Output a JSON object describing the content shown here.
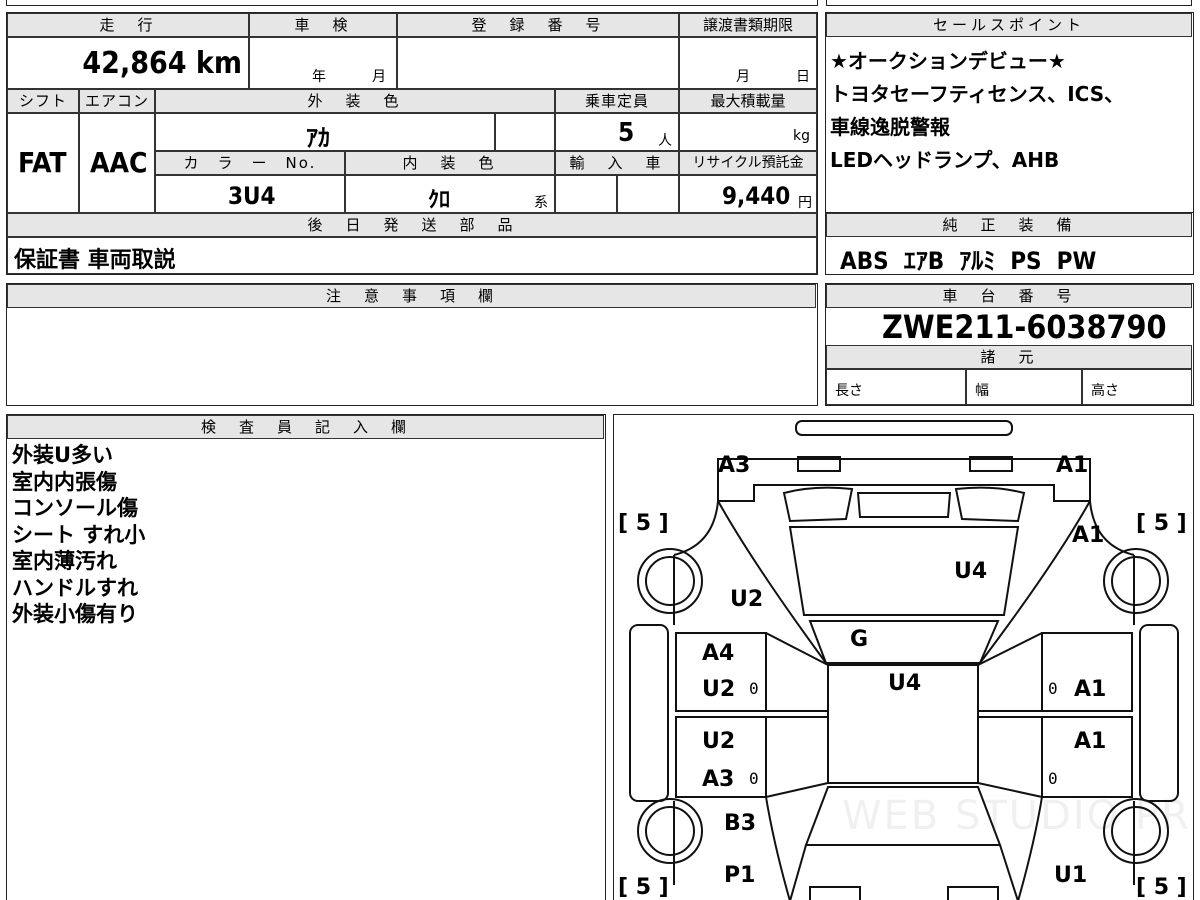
{
  "header": {
    "mileage_label": "走　行",
    "mileage_value": "42,864 km",
    "inspection_label": "車　検",
    "inspection_year": "年",
    "inspection_month": "月",
    "registration_label": "登　録　番　号",
    "transfer_label": "譲渡書類期限",
    "transfer_month": "月",
    "transfer_day": "日",
    "shift_label": "シフト",
    "shift_value": "FAT",
    "aircon_label": "エアコン",
    "aircon_value": "AAC",
    "exterior_label": "外　装　色",
    "exterior_value": "ｱｶ",
    "capacity_label": "乗車定員",
    "capacity_value": "5",
    "capacity_unit": "人",
    "maxload_label": "最大積載量",
    "maxload_unit": "kg",
    "color_no_label": "カ　ラ　ー　No.",
    "color_no_value": "3U4",
    "interior_label": "内　装　色",
    "interior_value": "ｸﾛ",
    "interior_unit": "系",
    "import_label": "輸　入　車",
    "recycle_label": "リサイクル預託金",
    "recycle_value": "9,440",
    "recycle_unit": "円",
    "later_parts_label": "後　日　発　送　部　品",
    "later_parts_value": "保証書 車両取説"
  },
  "sales": {
    "label": "セールスポイント",
    "lines": [
      "★オークションデビュー★",
      "トヨタセーフティセンス、ICS、",
      "車線逸脱警報",
      "LEDヘッドランプ、AHB"
    ]
  },
  "equipment": {
    "label": "純　正　装　備",
    "value": "ABS  ｴｱB  ｱﾙﾐ  PS  PW"
  },
  "notes": {
    "label": "注　意　事　項　欄"
  },
  "chassis": {
    "label": "車　台　番　号",
    "value": "ZWE211-6038790",
    "spec_label": "諸　元",
    "length": "長さ",
    "width": "幅",
    "height": "高さ"
  },
  "inspector": {
    "label": "検　査　員　記　入　欄",
    "lines": [
      "外装U多い",
      "室内内張傷",
      "コンソール傷",
      "シート すれ小",
      "室内薄汚れ",
      "ハンドルすれ",
      "外装小傷有り"
    ]
  },
  "diagram": {
    "labels": {
      "a3_top": "A3",
      "a1_top": "A1",
      "a1_right": "A1",
      "u4_hood": "U4",
      "u2_left": "U2",
      "g_glass": "G",
      "a4_left": "A4",
      "u2_frontdoor": "U2",
      "u4_roof": "U4",
      "a1_frontdoor_r": "A1",
      "u2_reardoor": "U2",
      "a1_reardoor_r": "A1",
      "a3_reardoor": "A3",
      "b3": "B3",
      "p1": "P1",
      "u1": "U1"
    },
    "brackets": {
      "left_top": "[ 5 ]",
      "right_top": "[ 5 ]",
      "left_bottom": "[ 5 ]",
      "right_bottom": "[ 5 ]"
    },
    "zeros": [
      "0",
      "0",
      "0",
      "0"
    ],
    "watermark": "WEB STUDIO PRO"
  }
}
